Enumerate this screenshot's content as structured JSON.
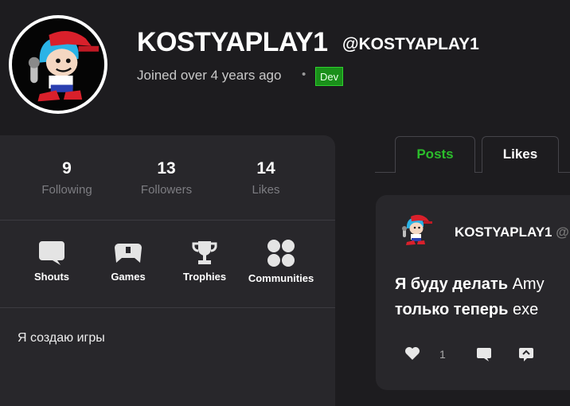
{
  "profile": {
    "username": "KOSTYAPLAY1",
    "handle": "@KOSTYAPLAY1",
    "joined": "Joined over 4 years ago",
    "separator": "•",
    "badge": "Dev",
    "bio": "Я создаю игры"
  },
  "stats": [
    {
      "value": "9",
      "label": "Following"
    },
    {
      "value": "13",
      "label": "Followers"
    },
    {
      "value": "14",
      "label": "Likes"
    }
  ],
  "tiles": [
    {
      "label": "Shouts",
      "icon": "speech-bubble-icon"
    },
    {
      "label": "Games",
      "icon": "gamepad-icon"
    },
    {
      "label": "Trophies",
      "icon": "trophy-icon"
    },
    {
      "label": "Communities",
      "icon": "communities-icon"
    }
  ],
  "tabs": [
    {
      "label": "Posts",
      "active": true
    },
    {
      "label": "Likes",
      "active": false
    }
  ],
  "post": {
    "author": "KOSTYAPLAY1",
    "author_tail": "@",
    "line1_bold": "Я буду делать",
    "line1_rest": " Amy",
    "line2_bold": "только теперь",
    "line2_rest": " exe",
    "likes": "1"
  },
  "colors": {
    "background": "#1d1c1f",
    "card": "#28272b",
    "accent_green": "#2bbd2b",
    "badge_green": "#1a8f1a"
  }
}
